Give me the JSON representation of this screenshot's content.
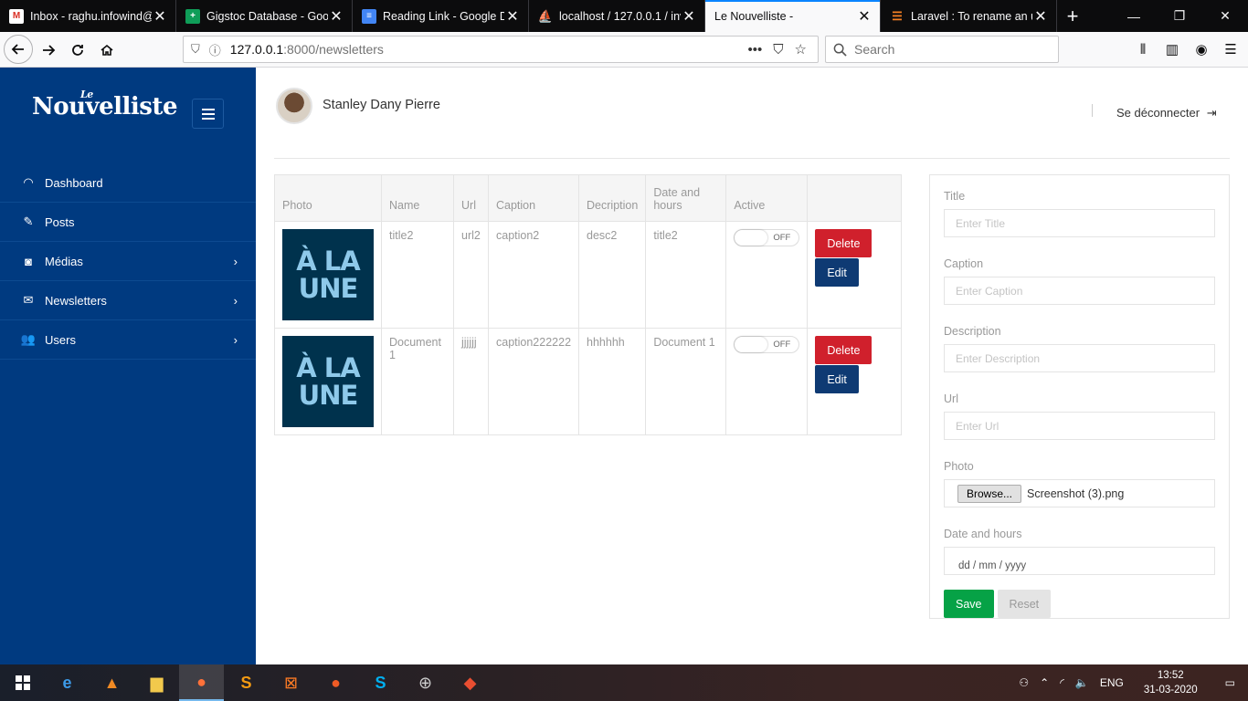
{
  "browser": {
    "tabs": [
      {
        "title": "Inbox - raghu.infowind@",
        "icon": "gmail-icon",
        "color": "#d93025"
      },
      {
        "title": "Gigstoc Database - Goog",
        "icon": "sheets-icon",
        "color": "#0f9d58"
      },
      {
        "title": "Reading Link - Google Do",
        "icon": "docs-icon",
        "color": "#4285f4"
      },
      {
        "title": "localhost / 127.0.0.1 / inv",
        "icon": "phpmyadmin-icon",
        "color": "#f89c0e"
      },
      {
        "title": "Le Nouvelliste -",
        "icon": "",
        "color": ""
      },
      {
        "title": "Laravel : To rename an up",
        "icon": "stackoverflow-icon",
        "color": "#f48024"
      }
    ],
    "url_host": "127.0.0.1",
    "url_rest": ":8000/newsletters",
    "search_placeholder": "Search"
  },
  "sidebar": {
    "logo_small": "Le",
    "logo": "Nouvelliste",
    "items": [
      {
        "label": "Dashboard",
        "icon": "gauge-icon",
        "has_chevron": false
      },
      {
        "label": "Posts",
        "icon": "pencil-icon",
        "has_chevron": false
      },
      {
        "label": "Médias",
        "icon": "camera-icon",
        "has_chevron": true
      },
      {
        "label": "Newsletters",
        "icon": "envelope-icon",
        "has_chevron": true
      },
      {
        "label": "Users",
        "icon": "users-icon",
        "has_chevron": true
      }
    ]
  },
  "header": {
    "user_name": "Stanley Dany Pierre",
    "logout": "Se déconnecter"
  },
  "table": {
    "columns": [
      "Photo",
      "Name",
      "Url",
      "Caption",
      "Decription",
      "Date and hours",
      "Active",
      ""
    ],
    "thumb_line1": "À LA",
    "thumb_line2": "UNE",
    "rows": [
      {
        "name": "title2",
        "url": "url2",
        "caption": "caption2",
        "description": "desc2",
        "date": "title2",
        "active": "OFF",
        "delete": "Delete",
        "edit": "Edit"
      },
      {
        "name": "Document 1",
        "url": "jjjjjj",
        "caption": "caption222222",
        "description": "hhhhhh",
        "date": "Document 1",
        "active": "OFF",
        "delete": "Delete",
        "edit": "Edit"
      }
    ]
  },
  "form": {
    "title_label": "Title",
    "title_placeholder": "Enter Title",
    "caption_label": "Caption",
    "caption_placeholder": "Enter Caption",
    "description_label": "Description",
    "description_placeholder": "Enter Description",
    "url_label": "Url",
    "url_placeholder": "Enter Url",
    "photo_label": "Photo",
    "browse": "Browse...",
    "file_name": "Screenshot (3).png",
    "date_label": "Date and hours",
    "date_value": "dd / mm / yyyy",
    "save": "Save",
    "reset": "Reset"
  },
  "taskbar": {
    "lang": "ENG",
    "time": "13:52",
    "date": "31-03-2020"
  }
}
